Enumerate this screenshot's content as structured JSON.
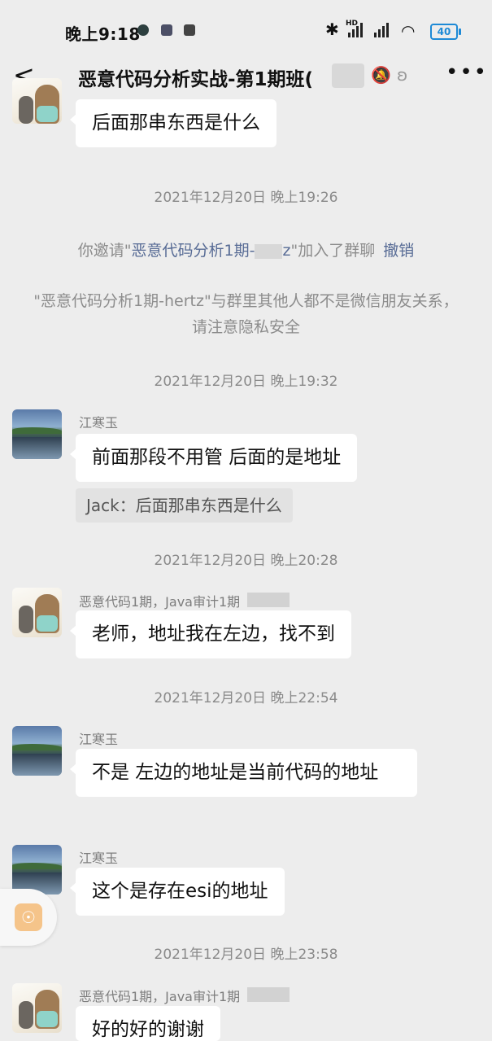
{
  "status_bar": {
    "time": "晚上9:18",
    "network": "HD",
    "battery": "40"
  },
  "nav": {
    "back_icon": "chevron-left-icon",
    "title": "恶意代码分析实战-第1期班(",
    "title_suffix": ")"
  },
  "messages": [
    {
      "type": "bubble",
      "avatar": "bear",
      "text": "后面那串东西是什么"
    },
    {
      "type": "time",
      "text": "2021年12月20日 晚上19:26"
    },
    {
      "type": "system",
      "prefix": "你邀请\"",
      "link": "恶意代码分析1期-",
      "suffix_link": "z",
      "after": "\"加入了群聊",
      "action": "撤销"
    },
    {
      "type": "system2",
      "text": "\"恶意代码分析1期-hertz\"与群里其他人都不是微信朋友关系，请注意隐私安全"
    },
    {
      "type": "time",
      "text": "2021年12月20日 晚上19:32"
    },
    {
      "type": "bubble",
      "avatar": "lake",
      "sender": "江寒玉",
      "text": "前面那段不用管 后面的是地址",
      "quote": "Jack：后面那串东西是什么"
    },
    {
      "type": "time",
      "text": "2021年12月20日 晚上20:28"
    },
    {
      "type": "bubble",
      "avatar": "bear",
      "sender": "恶意代码1期，Java审计1期",
      "text": "老师，地址我在左边，找不到"
    },
    {
      "type": "time",
      "text": "2021年12月20日 晚上22:54"
    },
    {
      "type": "bubble",
      "avatar": "lake",
      "sender": "江寒玉",
      "text": "不是 左边的地址是当前代码的地址"
    },
    {
      "type": "bubble",
      "avatar": "lake",
      "sender": "江寒玉",
      "text": "这个是存在esi的地址"
    },
    {
      "type": "time",
      "text": "2021年12月20日 晚上23:58"
    },
    {
      "type": "bubble",
      "avatar": "bear",
      "sender": "恶意代码1期，Java审计1期",
      "text": "好的好的谢谢"
    }
  ]
}
